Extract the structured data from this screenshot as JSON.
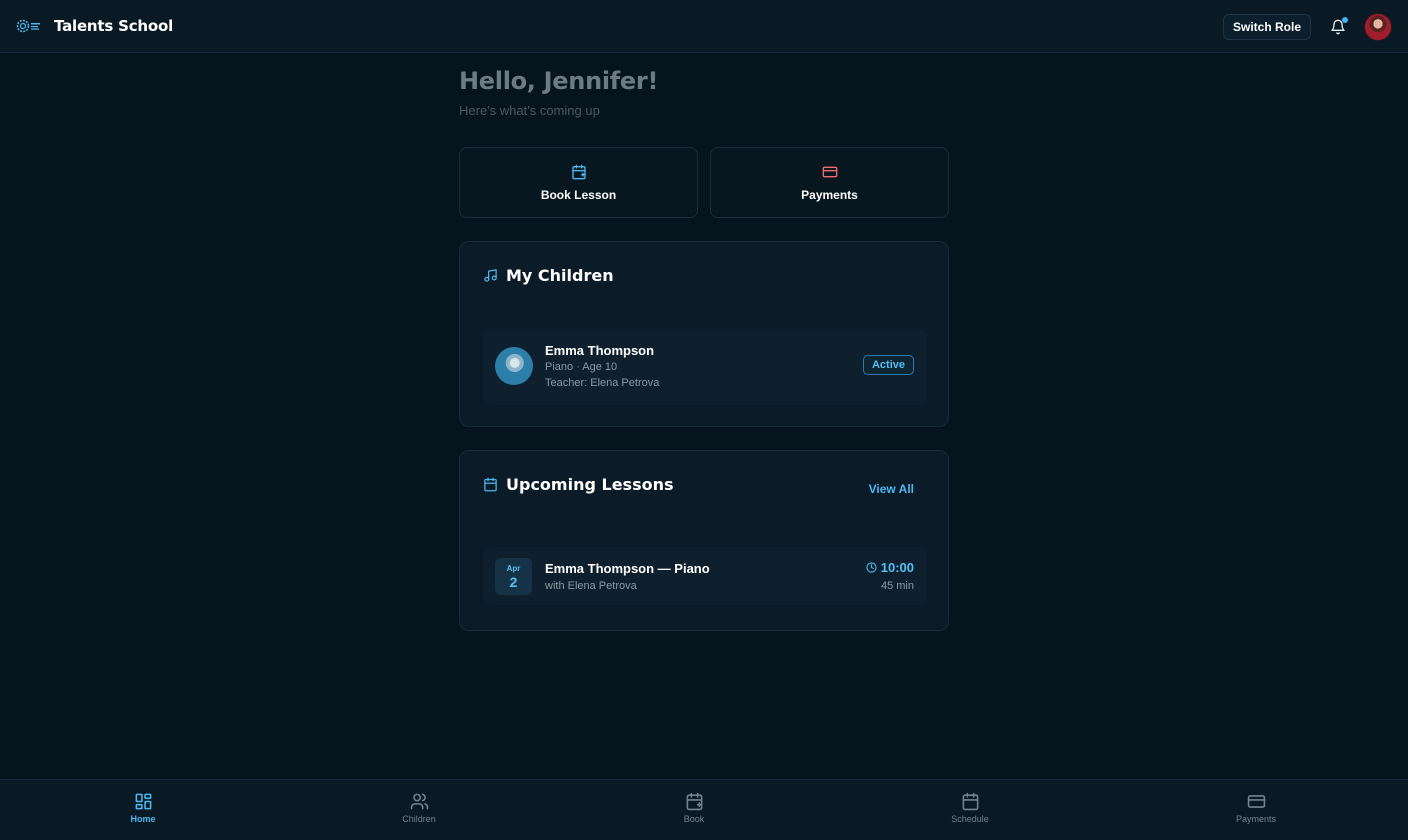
{
  "header": {
    "app_name": "Talents School",
    "switch_role_label": "Switch Role",
    "notification_dot": true
  },
  "greeting": {
    "title": "Hello, Jennifer!",
    "subtitle": "Here's what's coming up"
  },
  "quick_actions": [
    {
      "label": "Book Lesson",
      "icon": "calendar-plus-icon",
      "color": "#4db8f0"
    },
    {
      "label": "Payments",
      "icon": "credit-card-icon",
      "color": "#f26b6b"
    }
  ],
  "my_children": {
    "title": "My Children",
    "children": [
      {
        "name": "Emma Thompson",
        "info": "Piano · Age 10",
        "teacher": "Teacher: Elena Petrova",
        "status": "Active"
      }
    ]
  },
  "upcoming_lessons": {
    "title": "Upcoming Lessons",
    "view_all_label": "View All",
    "lessons": [
      {
        "month": "Apr",
        "day": "2",
        "title": "Emma Thompson — Piano",
        "subtitle": "with Elena Petrova",
        "time": "10:00",
        "duration": "45 min"
      }
    ]
  },
  "bottom_nav": [
    {
      "label": "Home",
      "icon": "grid-icon",
      "active": true
    },
    {
      "label": "Children",
      "icon": "users-icon",
      "active": false
    },
    {
      "label": "Book",
      "icon": "calendar-plus-icon",
      "active": false
    },
    {
      "label": "Schedule",
      "icon": "calendar-icon",
      "active": false
    },
    {
      "label": "Payments",
      "icon": "credit-card-icon",
      "active": false
    }
  ],
  "colors": {
    "background": "#06141d",
    "accent": "#4db8f0",
    "payments_accent": "#f26b6b"
  }
}
